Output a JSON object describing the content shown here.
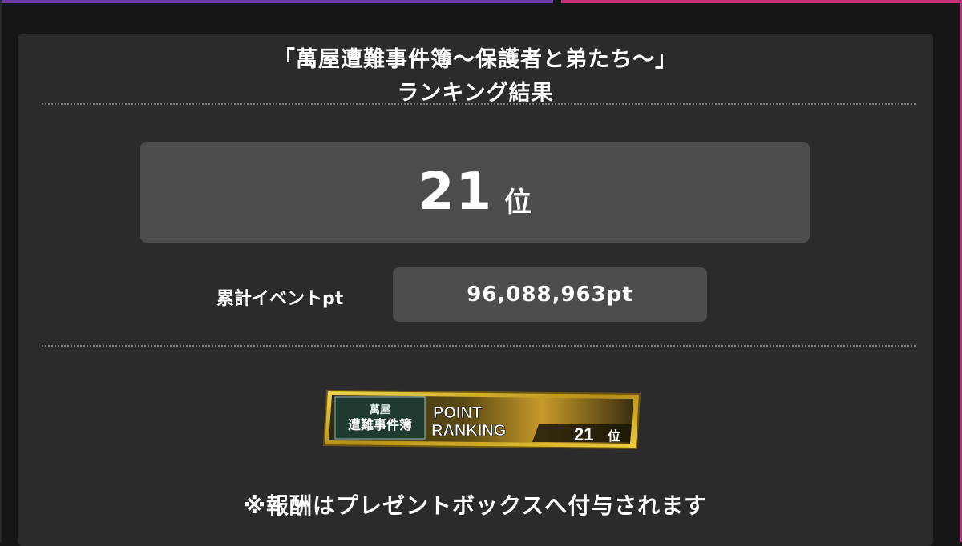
{
  "header": {
    "title_line1": "「萬屋遭難事件簿～保護者と弟たち～」",
    "title_line2": "ランキング結果"
  },
  "result": {
    "rank_number": "21",
    "rank_unit": "位",
    "points_label": "累計イベントpt",
    "points_value": "96,088,963pt"
  },
  "banner": {
    "logo_line1": "萬屋",
    "logo_line2": "遭難事件簿",
    "line1": "POINT",
    "line2": "RANKING",
    "rank_number": "21",
    "rank_unit": "位"
  },
  "note": "※報酬はプレゼントボックスへ付与されます",
  "colors": {
    "background": "#161616",
    "panel": "#2b2b2b",
    "box": "#4d4d4d",
    "banner_gold": "#c9a11c"
  }
}
